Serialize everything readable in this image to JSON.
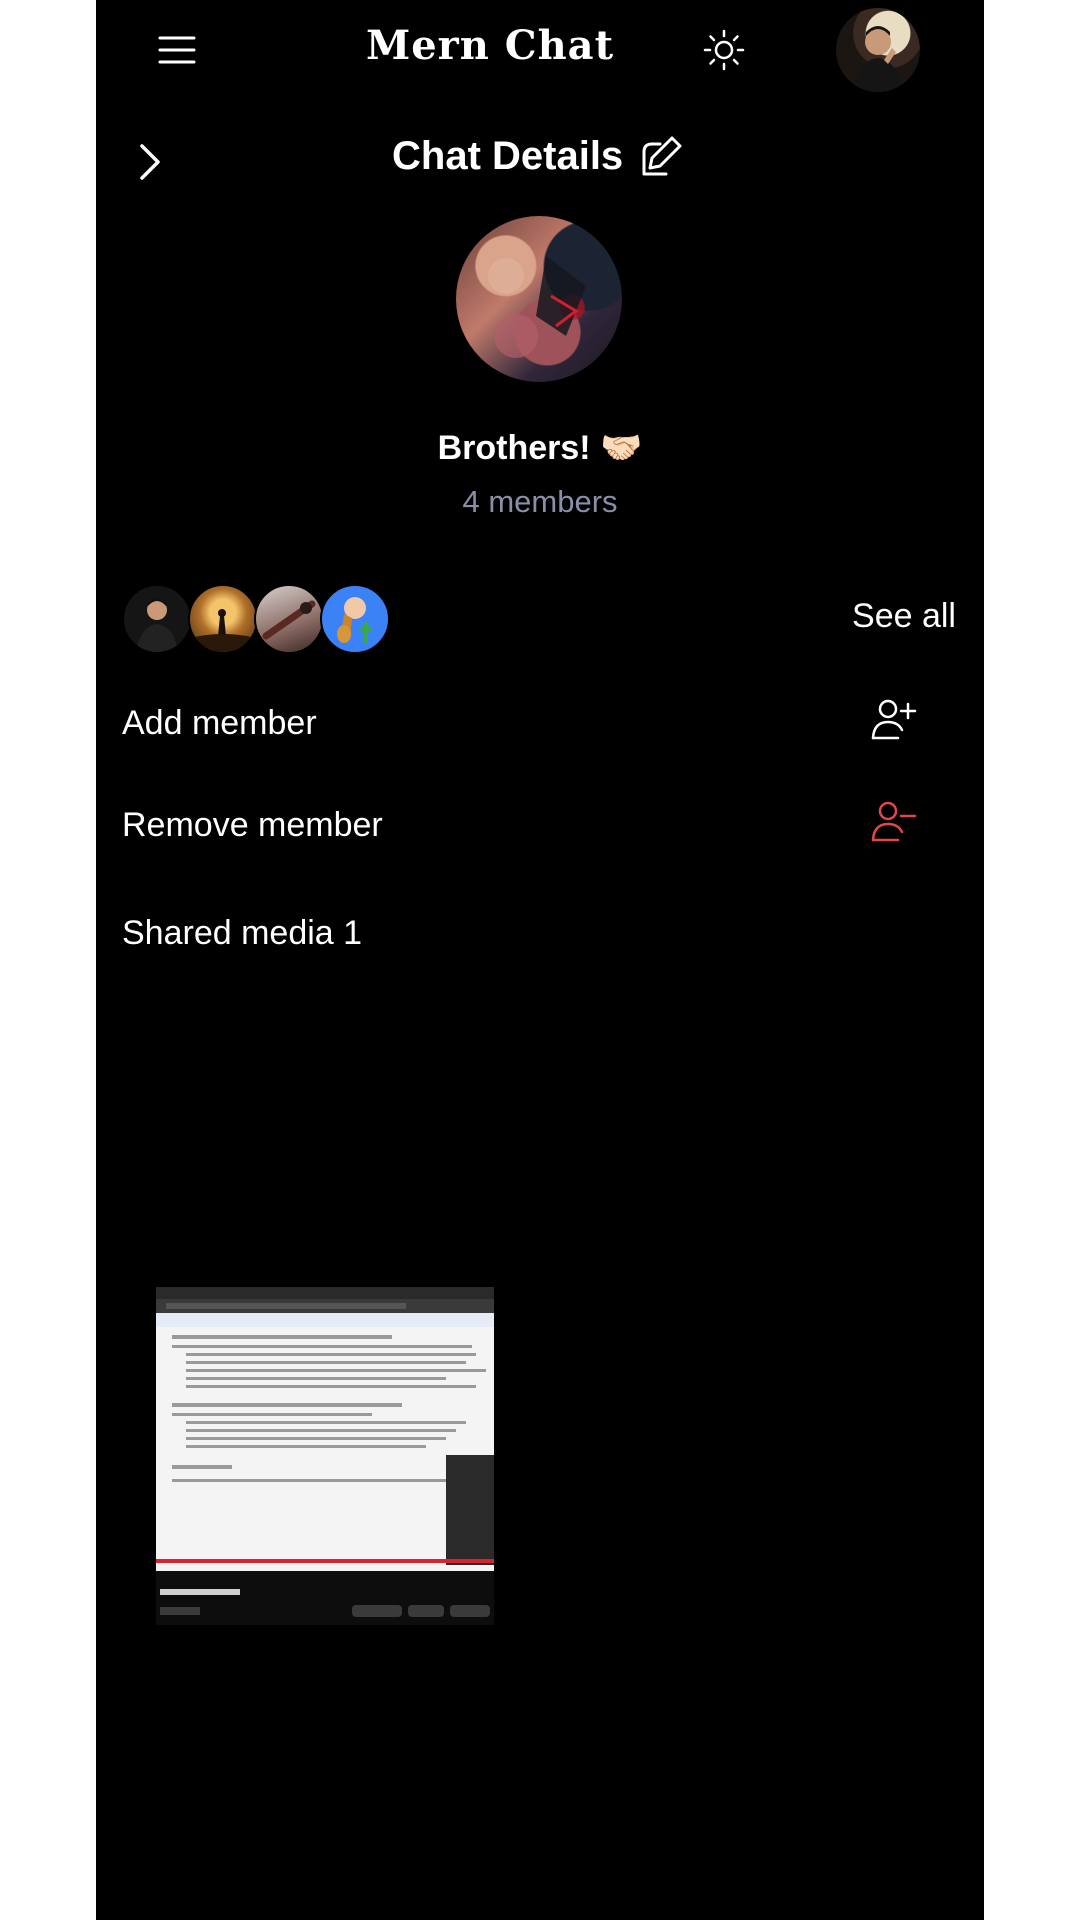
{
  "app": {
    "title": "Mern Chat",
    "icons": {
      "menu": "menu-icon",
      "theme": "sun-icon",
      "avatar": "user-avatar"
    }
  },
  "chat_details": {
    "title": "Chat Details",
    "back_icon": "chevron-right-icon",
    "edit_icon": "edit-icon",
    "group_name": "Brothers!",
    "group_emoji": "🤝🏻",
    "members_label": "4 members",
    "see_all_label": "See all",
    "member_avatars": [
      "member-avatar-1",
      "member-avatar-2",
      "member-avatar-3",
      "member-avatar-4"
    ],
    "add_member_label": "Add member",
    "remove_member_label": "Remove member",
    "shared_media_label": "Shared media 1",
    "colors": {
      "remove_icon": "#e04848",
      "members_text": "#8a8fa8",
      "background": "#000000"
    }
  }
}
